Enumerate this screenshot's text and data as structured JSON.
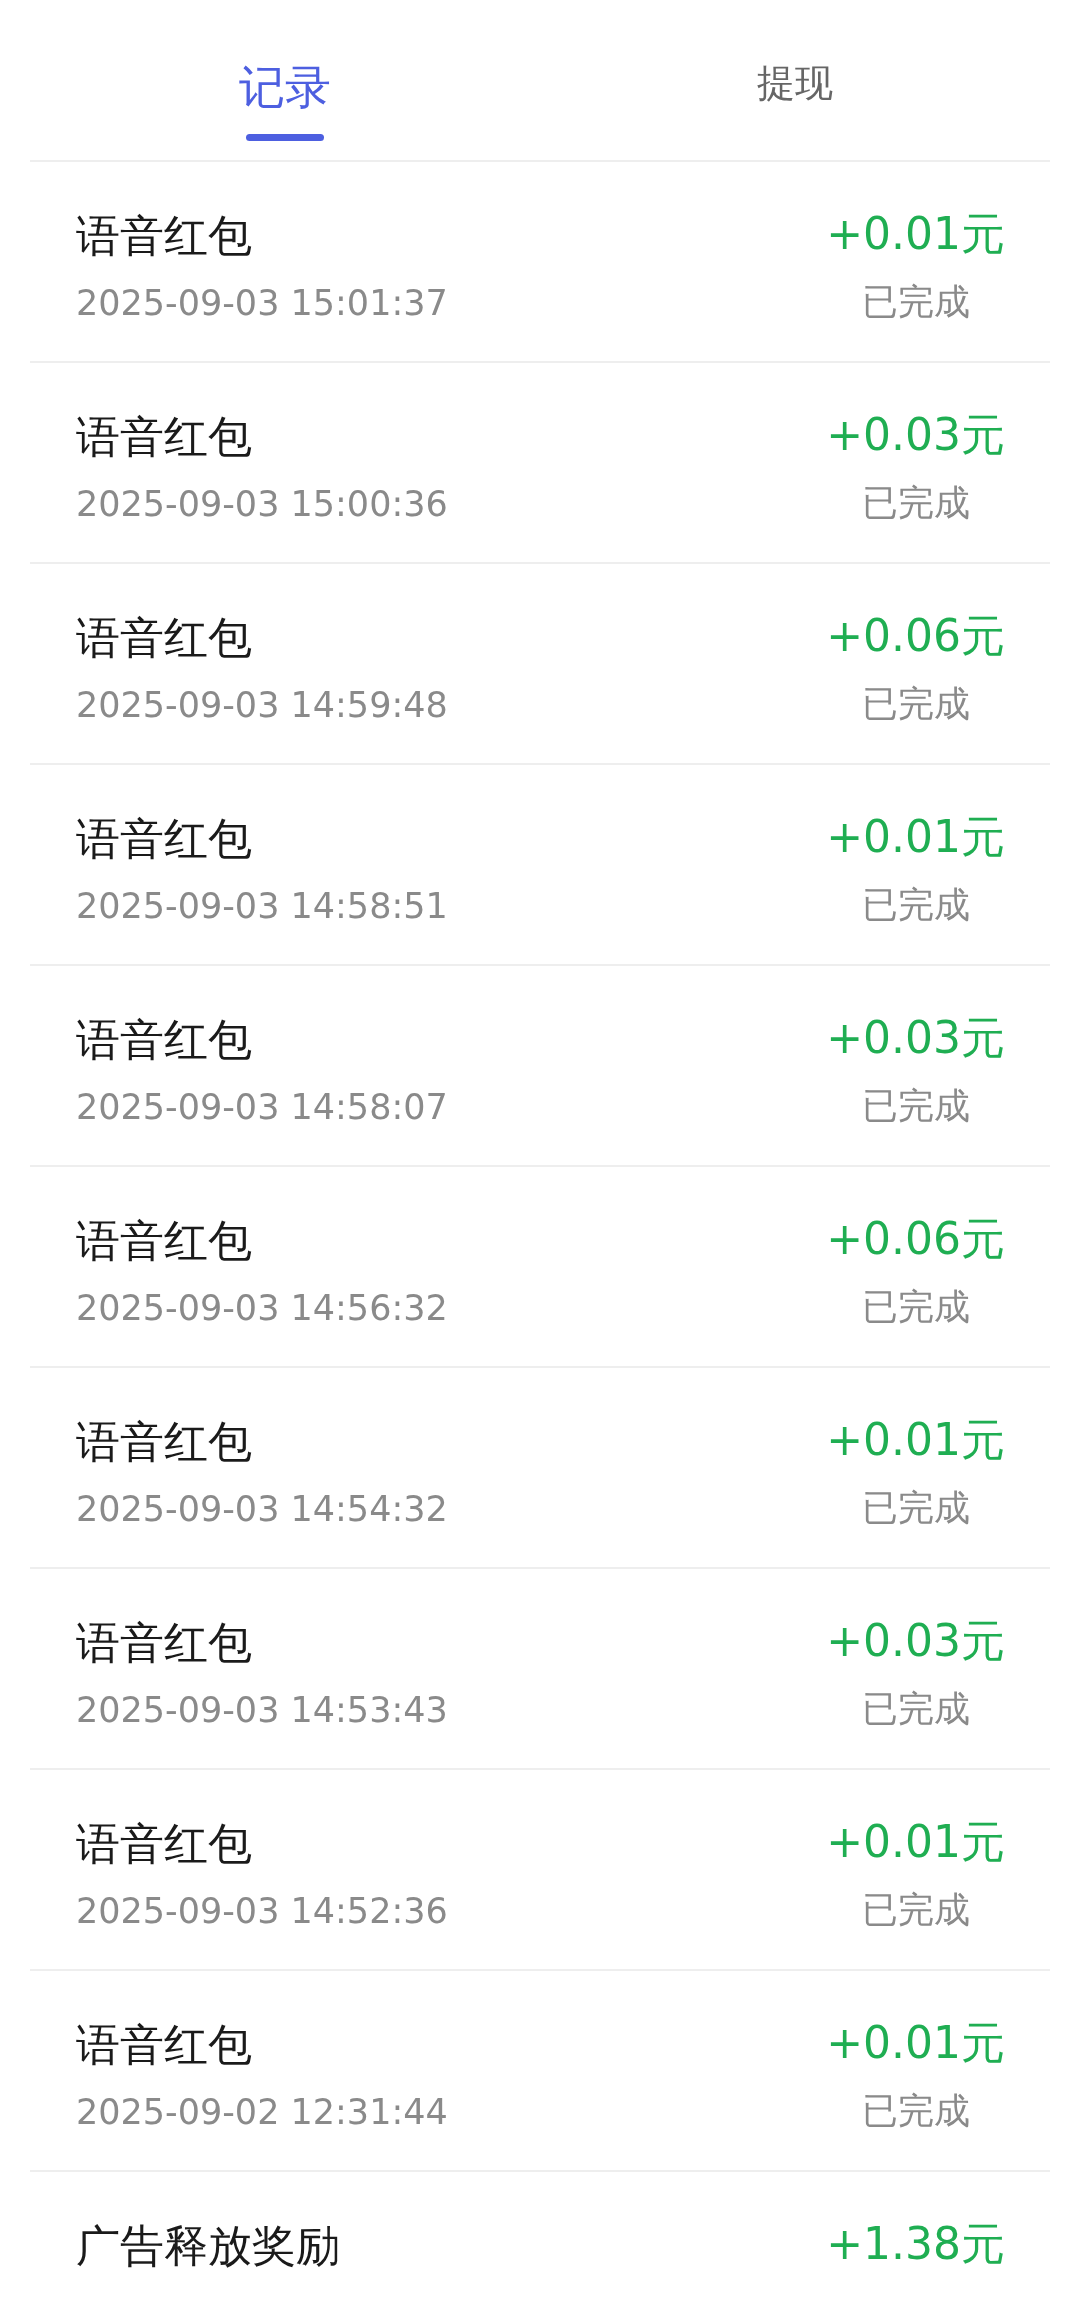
{
  "tabs": [
    {
      "label": "记录",
      "selected": true
    },
    {
      "label": "提现",
      "selected": false
    }
  ],
  "records": [
    {
      "title": "语音红包",
      "time": "2025-09-03 15:01:37",
      "amount": "+0.01元",
      "status": "已完成"
    },
    {
      "title": "语音红包",
      "time": "2025-09-03 15:00:36",
      "amount": "+0.03元",
      "status": "已完成"
    },
    {
      "title": "语音红包",
      "time": "2025-09-03 14:59:48",
      "amount": "+0.06元",
      "status": "已完成"
    },
    {
      "title": "语音红包",
      "time": "2025-09-03 14:58:51",
      "amount": "+0.01元",
      "status": "已完成"
    },
    {
      "title": "语音红包",
      "time": "2025-09-03 14:58:07",
      "amount": "+0.03元",
      "status": "已完成"
    },
    {
      "title": "语音红包",
      "time": "2025-09-03 14:56:32",
      "amount": "+0.06元",
      "status": "已完成"
    },
    {
      "title": "语音红包",
      "time": "2025-09-03 14:54:32",
      "amount": "+0.01元",
      "status": "已完成"
    },
    {
      "title": "语音红包",
      "time": "2025-09-03 14:53:43",
      "amount": "+0.03元",
      "status": "已完成"
    },
    {
      "title": "语音红包",
      "time": "2025-09-03 14:52:36",
      "amount": "+0.01元",
      "status": "已完成"
    },
    {
      "title": "语音红包",
      "time": "2025-09-02 12:31:44",
      "amount": "+0.01元",
      "status": "已完成"
    },
    {
      "title": "广告释放奖励",
      "amount": "+1.38元"
    }
  ]
}
